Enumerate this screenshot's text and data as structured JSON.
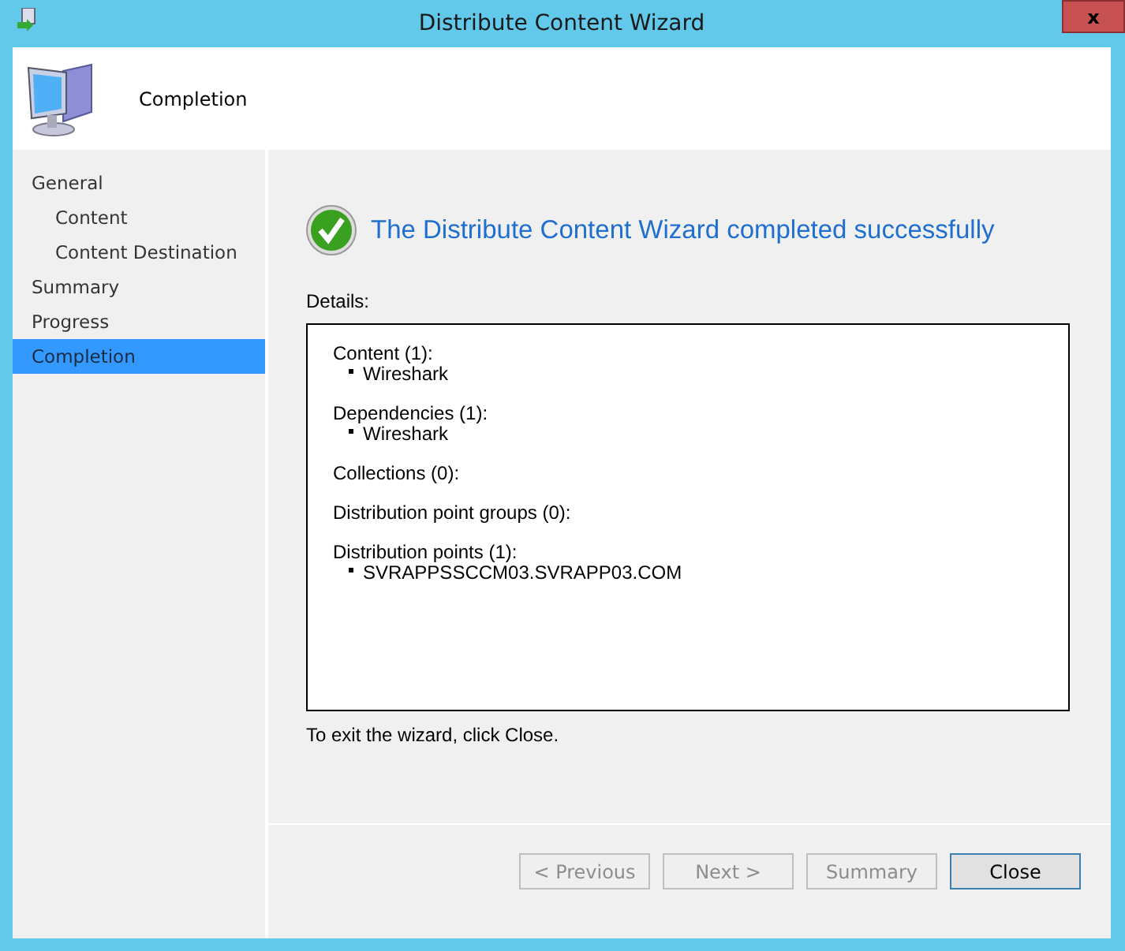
{
  "window": {
    "title": "Distribute Content Wizard",
    "close": "x"
  },
  "header": {
    "title": "Completion"
  },
  "sidebar": {
    "items": [
      {
        "label": "General",
        "selected": false,
        "children": [
          {
            "label": "Content",
            "selected": false
          },
          {
            "label": "Content Destination",
            "selected": false
          }
        ]
      },
      {
        "label": "Summary",
        "selected": false
      },
      {
        "label": "Progress",
        "selected": false
      },
      {
        "label": "Completion",
        "selected": true
      }
    ]
  },
  "result": {
    "message": "The Distribute Content Wizard completed successfully"
  },
  "details": {
    "label": "Details:",
    "sections": [
      {
        "heading": "Content (1):",
        "items": [
          "Wireshark"
        ]
      },
      {
        "heading": "Dependencies (1):",
        "items": [
          "Wireshark"
        ]
      },
      {
        "heading": "Collections (0):"
      },
      {
        "heading": "Distribution point groups (0):"
      },
      {
        "heading": "Distribution points (1):",
        "items": [
          "SVRAPPSSCCM03.SVRAPP03.COM"
        ]
      }
    ]
  },
  "hint": "To exit the wizard, click Close.",
  "buttons": [
    {
      "label": "< Previous",
      "disabled": true
    },
    {
      "label": "Next >",
      "disabled": true
    },
    {
      "label": "Summary",
      "disabled": true
    },
    {
      "label": "Close",
      "disabled": false
    }
  ]
}
